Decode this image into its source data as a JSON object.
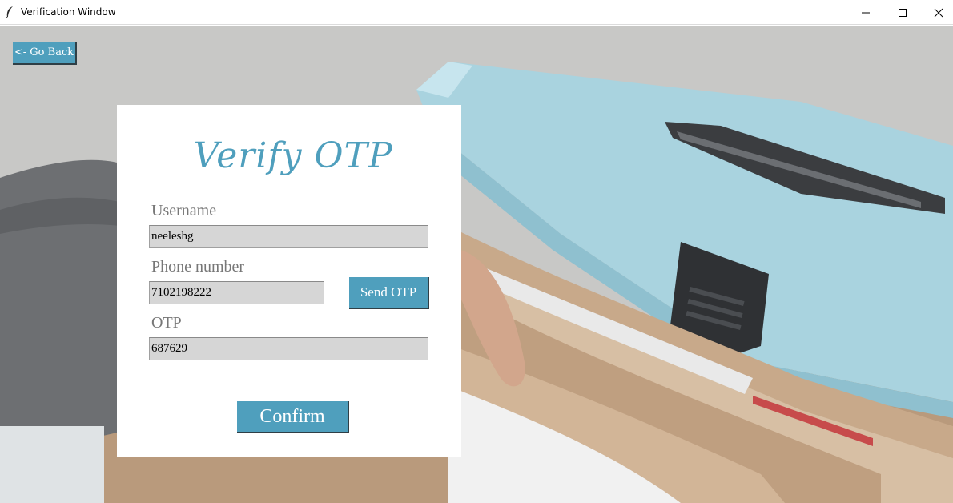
{
  "window": {
    "title": "Verification Window",
    "icon": "feather-icon",
    "controls": [
      "minimize-icon",
      "maximize-icon",
      "close-icon"
    ]
  },
  "nav": {
    "go_back_label": "<- Go Back"
  },
  "form": {
    "title": "Verify OTP",
    "username_label": "Username",
    "username_value": "neeleshg",
    "phone_label": "Phone number",
    "phone_value": "7102198222",
    "send_otp_label": "Send OTP",
    "otp_label": "OTP",
    "otp_value": "687629",
    "confirm_label": "Confirm"
  },
  "colors": {
    "accent": "#4f9fbd",
    "field_bg": "#d6d6d6",
    "label": "#777777"
  }
}
